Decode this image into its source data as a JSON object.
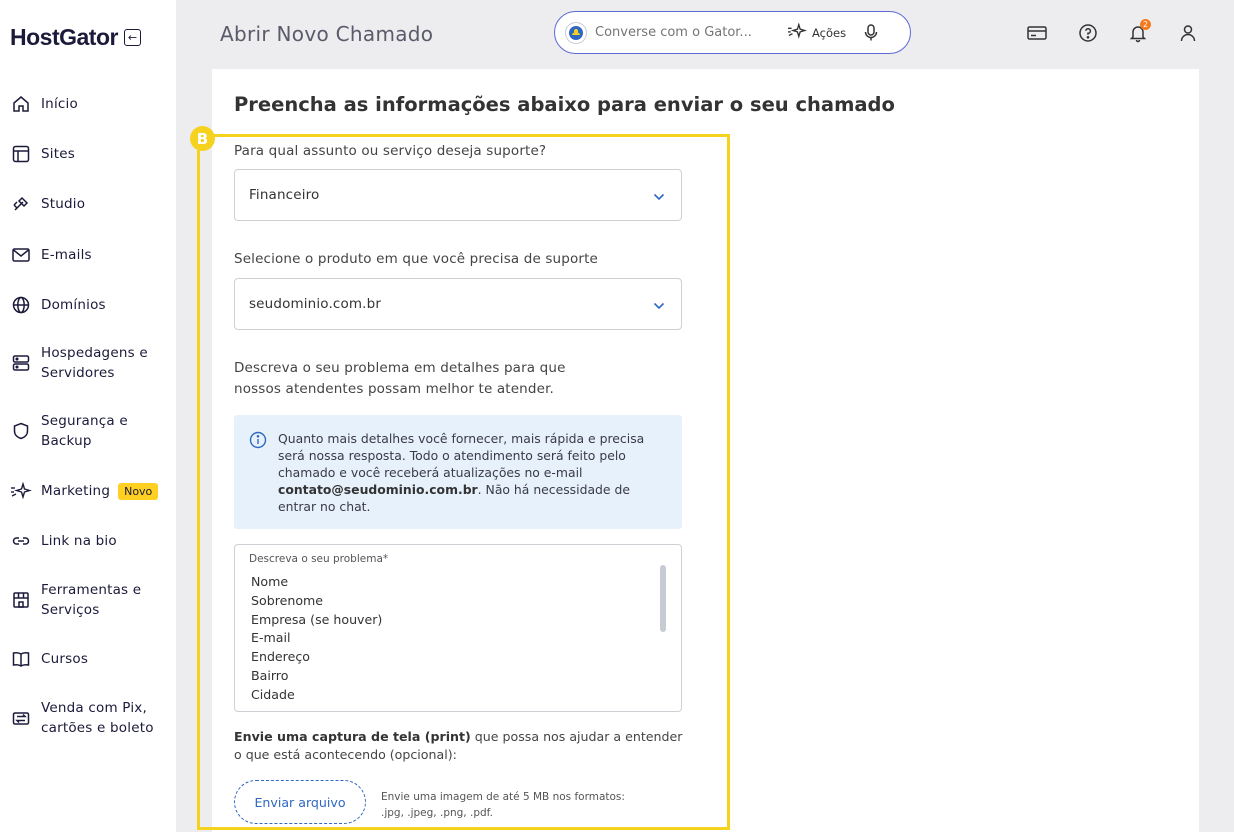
{
  "brand": {
    "name": "HostGator"
  },
  "sidebar": {
    "items": [
      {
        "label": "Início",
        "icon": "home-icon"
      },
      {
        "label": "Sites",
        "icon": "layout-icon"
      },
      {
        "label": "Studio",
        "icon": "studio-icon"
      },
      {
        "label": "E-mails",
        "icon": "mail-icon"
      },
      {
        "label": "Domínios",
        "icon": "globe-icon"
      },
      {
        "label": "Hospedagens e Servidores",
        "icon": "server-icon"
      },
      {
        "label": "Segurança e Backup",
        "icon": "shield-icon"
      },
      {
        "label": "Marketing",
        "icon": "sparkles-icon",
        "badge": "Novo"
      },
      {
        "label": "Link na bio",
        "icon": "link-icon"
      },
      {
        "label": "Ferramentas e Serviços",
        "icon": "store-icon"
      },
      {
        "label": "Cursos",
        "icon": "book-icon"
      },
      {
        "label": "Venda com Pix, cartões e boleto",
        "icon": "payment-icon"
      }
    ]
  },
  "header": {
    "title": "Abrir Novo Chamado",
    "chat_placeholder": "Converse com o Gator...",
    "actions_label": "Ações",
    "notification_count": "2"
  },
  "form": {
    "heading": "Preencha as informações abaixo para enviar o seu chamado",
    "step_marker": "B",
    "subject_label": "Para qual assunto ou serviço deseja suporte?",
    "subject_value": "Financeiro",
    "product_label": "Selecione o produto em que você precisa de suporte",
    "product_value": "seudominio.com.br",
    "describe_label_line1": "Descreva o seu problema em detalhes para que",
    "describe_label_line2": "nossos atendentes possam melhor te atender.",
    "info_part1": "Quanto mais detalhes você fornecer, mais rápida e precisa será nossa resposta. Todo o atendimento será feito pelo chamado e você receberá atualizações no e-mail ",
    "info_email": "contato@seudominio.com.br",
    "info_part2": ". Não há necessidade de entrar no chat.",
    "textarea_label": "Descreva o seu problema*",
    "textarea_lines": [
      "Nome",
      "Sobrenome",
      "Empresa (se houver)",
      "E-mail",
      "Endereço",
      "Bairro",
      "Cidade"
    ],
    "upload_bold": "Envie uma captura de tela (print)",
    "upload_rest": " que possa nos ajudar a entender o que está acontecendo (opcional):",
    "upload_button": "Enviar arquivo",
    "upload_hint_line1": "Envie uma imagem de até 5 MB nos formatos:",
    "upload_hint_line2": ".jpg, .jpeg, .png, .pdf."
  },
  "colors": {
    "highlight": "#f5d21e",
    "accent_blue": "#2f68c2",
    "badge_yellow": "#ffd021",
    "notification_orange": "#f47b20",
    "info_bg": "#e6f1fb"
  }
}
